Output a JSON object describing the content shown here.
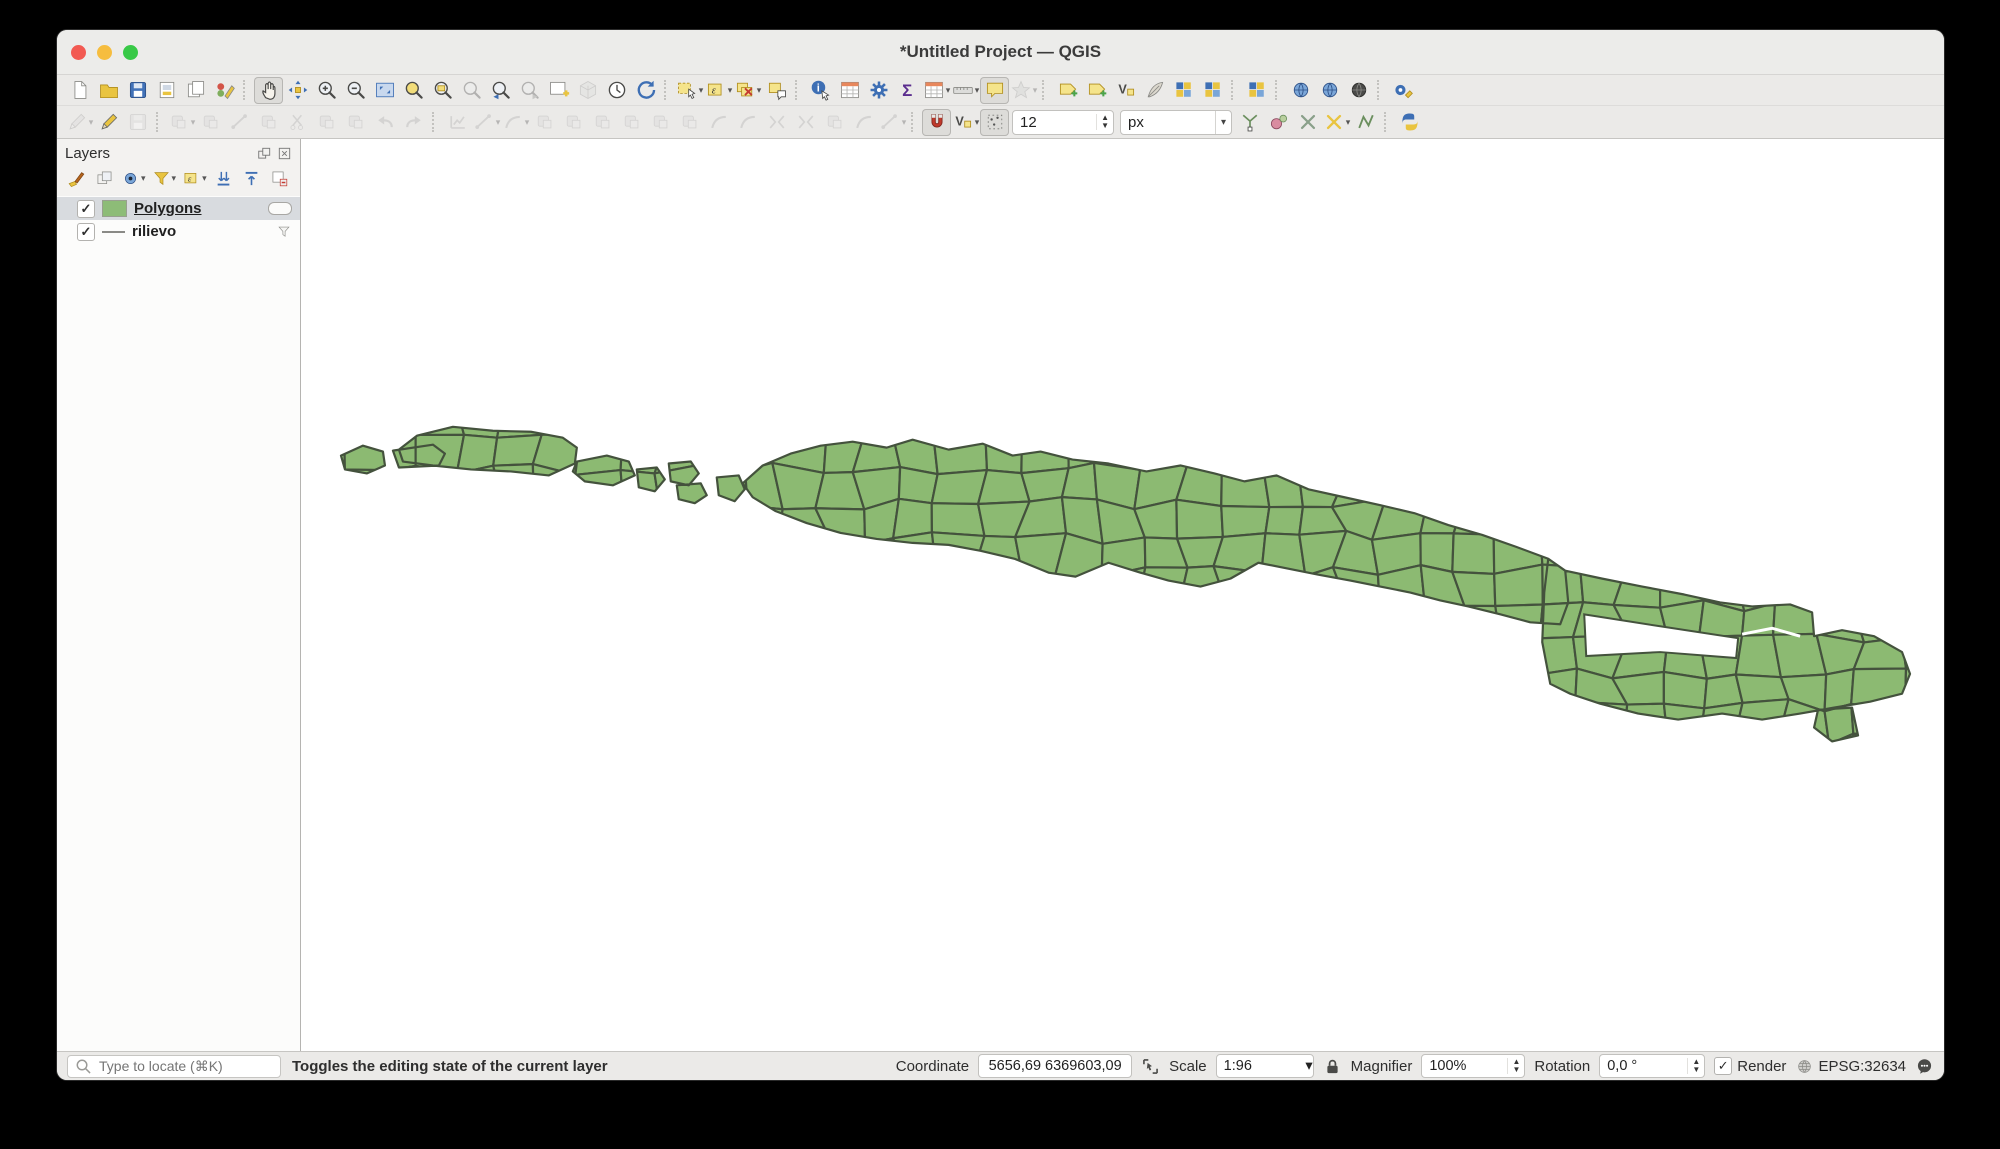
{
  "window": {
    "title": "*Untitled Project — QGIS"
  },
  "toolbar_main": {
    "groups": [
      [
        {
          "n": "new-project-button",
          "k": "page"
        },
        {
          "n": "open-project-button",
          "k": "folder"
        },
        {
          "n": "save-project-button",
          "k": "floppy"
        },
        {
          "n": "new-print-layout-button",
          "k": "layout"
        },
        {
          "n": "show-layout-manager-button",
          "k": "layouts"
        },
        {
          "n": "style-manager-button",
          "k": "palette"
        }
      ],
      [
        {
          "n": "pan-map-button",
          "k": "hand",
          "s": "a"
        },
        {
          "n": "pan-to-selection-button",
          "k": "arrows4"
        },
        {
          "n": "zoom-in-button",
          "k": "zoomin"
        },
        {
          "n": "zoom-out-button",
          "k": "zoomout"
        },
        {
          "n": "zoom-full-button",
          "k": "zoomfull"
        },
        {
          "n": "zoom-to-selection-button",
          "k": "zoomsel"
        },
        {
          "n": "zoom-to-layer-button",
          "k": "zoomlayer"
        },
        {
          "n": "zoom-to-native-button",
          "k": "zoom",
          "s": "d"
        },
        {
          "n": "zoom-last-button",
          "k": "zoomlast"
        },
        {
          "n": "zoom-next-button",
          "k": "zoomnext",
          "s": "d"
        },
        {
          "n": "new-map-view-button",
          "k": "newmap"
        },
        {
          "n": "new-3d-map-view-button",
          "k": "map3d",
          "s": "d"
        },
        {
          "n": "temporal-controller-button",
          "k": "clock"
        },
        {
          "n": "refresh-map-button",
          "k": "refresh"
        }
      ],
      [
        {
          "n": "select-features-button",
          "k": "cursorsel",
          "d": 1
        },
        {
          "n": "select-by-expression-button",
          "k": "epsilon",
          "d": 1
        },
        {
          "n": "deselect-features-button",
          "k": "desel",
          "d": 1
        },
        {
          "n": "select-by-form-button",
          "k": "formsel"
        }
      ],
      [
        {
          "n": "identify-features-button",
          "k": "info"
        },
        {
          "n": "open-attribute-table-button",
          "k": "table"
        },
        {
          "n": "options-button",
          "k": "gear"
        },
        {
          "n": "statistics-button",
          "k": "sigma"
        },
        {
          "n": "attribute-table-dropdown",
          "k": "table",
          "d": 1
        },
        {
          "n": "measure-button",
          "k": "ruler",
          "d": 1
        },
        {
          "n": "map-tips-button",
          "k": "bubble",
          "s": "a"
        },
        {
          "n": "new-bookmark-button",
          "k": "star",
          "s": "d",
          "d": 1
        }
      ],
      [
        {
          "n": "new-labels-button",
          "k": "tag"
        },
        {
          "n": "configure-labels-button",
          "k": "tag"
        },
        {
          "n": "move-label-button",
          "k": "vsub"
        },
        {
          "n": "rotate-label-button",
          "k": "feather"
        },
        {
          "n": "change-label-button",
          "k": "diagram"
        },
        {
          "n": "layer-labeling-options-button",
          "k": "diagram"
        }
      ],
      [
        {
          "n": "diagram-options-button",
          "k": "diagram"
        }
      ],
      [
        {
          "n": "metasearch-button",
          "k": "web"
        },
        {
          "n": "web-service-button",
          "k": "web"
        },
        {
          "n": "qgis-hub-button",
          "k": "webdark"
        }
      ],
      [
        {
          "n": "processing-toolbox-button",
          "k": "processing"
        }
      ]
    ]
  },
  "toolbar_digitizing": {
    "size_value": "12",
    "unit_value": "px",
    "groups": [
      [
        {
          "n": "current-edits-button",
          "k": "pencilgray",
          "s": "d",
          "d": 1
        },
        {
          "n": "toggle-editing-button",
          "k": "pencil"
        },
        {
          "n": "save-layer-edits-button",
          "k": "floppygray",
          "s": "d"
        }
      ],
      [
        {
          "n": "digitize-with-segment-button",
          "k": "gblock",
          "s": "d",
          "d": 1
        },
        {
          "n": "add-feature-button",
          "k": "gblock",
          "s": "d"
        },
        {
          "n": "move-feature-button",
          "k": "gslash",
          "s": "d"
        },
        {
          "n": "delete-selected-button",
          "k": "gblock",
          "s": "d"
        },
        {
          "n": "cut-features-button",
          "k": "gcut",
          "s": "d"
        },
        {
          "n": "copy-features-button",
          "k": "gblock",
          "s": "d"
        },
        {
          "n": "paste-features-button",
          "k": "gblock",
          "s": "d"
        },
        {
          "n": "undo-button",
          "k": "gundo",
          "s": "d"
        },
        {
          "n": "redo-button",
          "k": "gredo",
          "s": "d"
        }
      ],
      [
        {
          "n": "enable-advanced-digitizing-button",
          "k": "gchart",
          "s": "d"
        },
        {
          "n": "advanced-tools-dropdown",
          "k": "gslash",
          "s": "d",
          "d": 1
        },
        {
          "n": "rotate-feature-button",
          "k": "gcurve",
          "s": "d",
          "d": 1
        },
        {
          "n": "simplify-feature-button",
          "k": "gblock",
          "s": "d"
        },
        {
          "n": "add-ring-button",
          "k": "gblock",
          "s": "d"
        },
        {
          "n": "add-part-button",
          "k": "gblock",
          "s": "d"
        },
        {
          "n": "fill-ring-button",
          "k": "gblock",
          "s": "d"
        },
        {
          "n": "delete-ring-button",
          "k": "gblock",
          "s": "d"
        },
        {
          "n": "delete-part-button",
          "k": "gblock",
          "s": "d"
        },
        {
          "n": "reshape-features-button",
          "k": "gcurve",
          "s": "d"
        },
        {
          "n": "offset-curve-button",
          "k": "gcurve",
          "s": "d"
        },
        {
          "n": "split-features-button",
          "k": "gsplit",
          "s": "d"
        },
        {
          "n": "split-parts-button",
          "k": "gsplit",
          "s": "d"
        },
        {
          "n": "merge-features-button",
          "k": "gblock",
          "s": "d"
        },
        {
          "n": "rotate-point-symbols-button",
          "k": "gcurve",
          "s": "d"
        },
        {
          "n": "trim-extend-button",
          "k": "gslash",
          "s": "d",
          "d": 1
        }
      ],
      [
        {
          "n": "enable-snapping-button",
          "k": "magnet",
          "s": "a"
        },
        {
          "n": "snapping-mode-dropdown",
          "k": "vsub",
          "d": 1
        },
        {
          "n": "snap-on-intersection-button",
          "k": "dotbox",
          "s": "a"
        },
        {
          "t": "spin",
          "n": "snapping-tolerance-spinbox"
        },
        {
          "t": "combo",
          "n": "snapping-unit-combo"
        },
        {
          "n": "vertex-tool-button",
          "k": "ytool"
        },
        {
          "n": "vertex-editor-button",
          "k": "vedit"
        },
        {
          "n": "delete-vertex-button",
          "k": "xgray"
        },
        {
          "n": "vertex-tool-current-layer-button",
          "k": "xyellow",
          "d": 1
        },
        {
          "n": "tracing-button",
          "k": "ntool"
        }
      ],
      [
        {
          "n": "python-console-button",
          "k": "python"
        }
      ]
    ]
  },
  "layers_panel": {
    "title": "Layers",
    "toolbar": [
      {
        "n": "layer-styling-button",
        "k": "brush"
      },
      {
        "n": "add-group-button",
        "k": "group"
      },
      {
        "n": "manage-map-themes-button",
        "k": "eye",
        "d": 1
      },
      {
        "n": "filter-legend-button",
        "k": "funnel",
        "d": 1
      },
      {
        "n": "filter-by-expression-button",
        "k": "epsilon",
        "d": 1
      },
      {
        "n": "expand-all-button",
        "k": "expand"
      },
      {
        "n": "collapse-all-button",
        "k": "collapse"
      },
      {
        "n": "remove-layer-button",
        "k": "removelayer"
      }
    ],
    "layers": [
      {
        "label": "Polygons",
        "checked": true,
        "selected": true,
        "symbol": "polygon",
        "swatch": "#8dbc77",
        "badge": "edit-indicator"
      },
      {
        "label": "rilievo",
        "checked": true,
        "selected": false,
        "symbol": "line",
        "badge": "filter-indicator"
      }
    ]
  },
  "status_bar": {
    "locate_placeholder": "Type to locate (⌘K)",
    "message": "Toggles the editing state of the current layer",
    "coordinate_label": "Coordinate",
    "coordinate_value": "5656,69 6369603,09",
    "scale_label": "Scale",
    "scale_value": "1:96",
    "magnifier_label": "Magnifier",
    "magnifier_value": "100%",
    "rotation_label": "Rotation",
    "rotation_value": "0,0 °",
    "render_label": "Render",
    "crs_value": "EPSG:32634"
  },
  "map": {
    "background": "#ffffff",
    "polygon_fill": "#8cba72",
    "polygon_stroke": "#44523d",
    "layer_names": [
      "Polygons",
      "rilievo"
    ]
  },
  "titlebar_colors": {
    "close": "#f25a52",
    "minimize": "#f6bd3f",
    "zoom": "#38c947"
  }
}
